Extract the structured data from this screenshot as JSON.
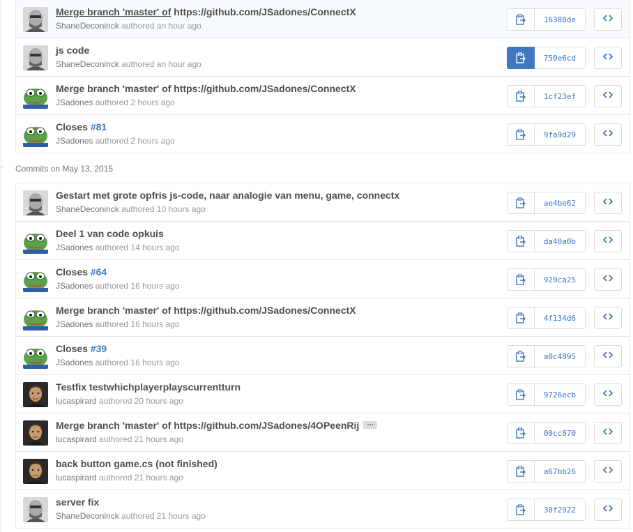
{
  "section_heading": {
    "label": "Commits on",
    "date": "May 13, 2015"
  },
  "groups": [
    {
      "rows": [
        {
          "title_prefix": "Merge branch 'master' of",
          "title_suffix": " https://github.com/JSadones/ConnectX",
          "author": "ShaneDeconinck",
          "time": "authored an hour ago",
          "sha": "16388de",
          "avatar": "shane"
        },
        {
          "title": "js code",
          "author": "ShaneDeconinck",
          "time": "authored an hour ago",
          "sha": "750e6cd",
          "avatar": "shane",
          "active": true
        },
        {
          "title": "Merge branch 'master' of https://github.com/JSadones/ConnectX",
          "author": "JSadones",
          "time": "authored 2 hours ago",
          "sha": "1cf23ef",
          "avatar": "pepe"
        },
        {
          "title": "Closes ",
          "issue": "#81",
          "author": "JSadones",
          "time": "authored 2 hours ago",
          "sha": "9fa9d29",
          "avatar": "pepe"
        }
      ]
    },
    {
      "rows": [
        {
          "title": "Gestart met grote opfris js-code, naar analogie van menu, game, connectx",
          "author": "ShaneDeconinck",
          "time": "authored 10 hours ago",
          "sha": "ae4be62",
          "avatar": "shane"
        },
        {
          "title": "Deel 1 van code opkuis",
          "author": "JSadones",
          "time": "authored 14 hours ago",
          "sha": "da40a0b",
          "avatar": "pepe"
        },
        {
          "title": "Closes ",
          "issue": "#64",
          "author": "JSadones",
          "time": "authored 16 hours ago",
          "sha": "929ca25",
          "avatar": "pepe"
        },
        {
          "title": "Merge branch 'master' of https://github.com/JSadones/ConnectX",
          "author": "JSadones",
          "time": "authored 16 hours ago",
          "sha": "4f134d6",
          "avatar": "pepe"
        },
        {
          "title": "Closes ",
          "issue": "#39",
          "author": "JSadones",
          "time": "authored 16 hours ago",
          "sha": "a0c4895",
          "avatar": "pepe"
        },
        {
          "title": "Testfix testwhichplayerplayscurrentturn",
          "author": "lucaspirard",
          "time": "authored 20 hours ago",
          "sha": "9726ecb",
          "avatar": "lucas"
        },
        {
          "title": "Merge branch 'master' of https://github.com/JSadones/4OPeenRij",
          "ellipsis": "…",
          "author": "lucaspirard",
          "time": "authored 21 hours ago",
          "sha": "00cc870",
          "avatar": "lucas"
        },
        {
          "title": "back button game.cs (not finished)",
          "author": "lucaspirard",
          "time": "authored 21 hours ago",
          "sha": "a67bb26",
          "avatar": "lucas"
        },
        {
          "title": "server fix",
          "author": "ShaneDeconinck",
          "time": "authored 21 hours ago",
          "sha": "30f2922",
          "avatar": "shane"
        }
      ]
    }
  ],
  "colors": {
    "link": "#4078c0",
    "active_button": "#4078c0",
    "border": "#e5e5e5"
  },
  "icons": {
    "copy": "clipboard-icon",
    "browse": "code-icon"
  }
}
